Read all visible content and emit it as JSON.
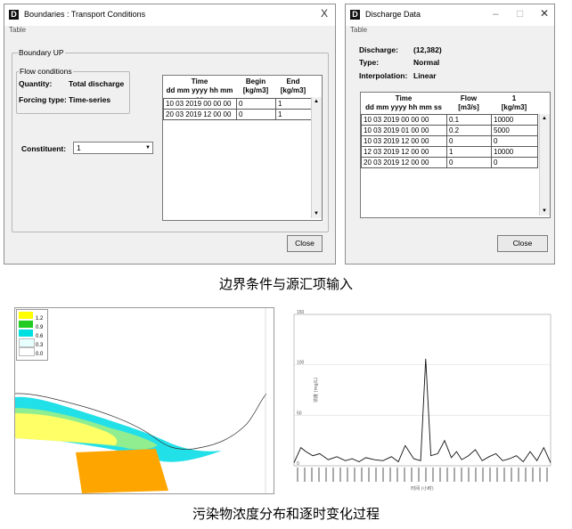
{
  "boundaries_window": {
    "title": "Boundaries : Transport Conditions",
    "menu": "Table",
    "close_glyph": "X",
    "group_label": "Boundary UP",
    "flow_group_label": "Flow conditions",
    "quantity_label": "Quantity:",
    "quantity_value": "Total discharge",
    "forcing_label": "Forcing type:",
    "forcing_value": "Time-series",
    "constituent_label": "Constituent:",
    "constituent_value": "1",
    "table": {
      "headers": [
        {
          "top": "Time",
          "bottom": "dd mm yyyy hh mm ss"
        },
        {
          "top": "Begin",
          "bottom": "[kg/m3]"
        },
        {
          "top": "End",
          "bottom": "[kg/m3]"
        }
      ],
      "rows": [
        [
          "10 03 2019 00 00 00",
          "0",
          "1"
        ],
        [
          "20 03 2019 12 00 00",
          "0",
          "1"
        ]
      ]
    },
    "close_button": "Close"
  },
  "discharge_window": {
    "title": "Discharge Data",
    "menu": "Table",
    "min_glyph": "–",
    "max_glyph": "□",
    "close_glyph": "✕",
    "discharge_label": "Discharge:",
    "discharge_value": "(12,382)",
    "type_label": "Type:",
    "type_value": "Normal",
    "interp_label": "Interpolation:",
    "interp_value": "Linear",
    "table": {
      "headers": [
        {
          "top": "Time",
          "bottom": "dd mm yyyy hh mm ss"
        },
        {
          "top": "Flow",
          "bottom": "[m3/s]"
        },
        {
          "top": "1",
          "bottom": "[kg/m3]"
        }
      ],
      "rows": [
        [
          "10 03 2019 00 00 00",
          "0.1",
          "10000"
        ],
        [
          "10 03 2019 01 00 00",
          "0.2",
          "5000"
        ],
        [
          "10 03 2019 12 00 00",
          "0",
          "0"
        ],
        [
          "12 03 2019 12 00 00",
          "1",
          "10000"
        ],
        [
          "20 03 2019 12 00 00",
          "0",
          "0"
        ]
      ]
    },
    "close_button": "Close"
  },
  "caption_top": "边界条件与源汇项输入",
  "caption_bottom": "污染物浓度分布和逐时变化过程",
  "map_legend": [
    {
      "value": "1.2",
      "color": "#ffff00"
    },
    {
      "value": "0.9",
      "color": "#22cc22"
    },
    {
      "value": "0.6",
      "color": "#00e0e0"
    },
    {
      "value": "0.3",
      "color": "#e8ffff"
    },
    {
      "value": "0.0",
      "color": "#ffffff"
    }
  ],
  "map_colors": {
    "plume_outer": "#22e0e8",
    "plume_mid": "#90ee90",
    "plume_core": "#ffff66",
    "land": "#ffa500"
  },
  "chart_data": {
    "type": "line",
    "ylabel": "浓度 (mg/L)",
    "xlabel": "时间 (小时)",
    "ylim": [
      0,
      150
    ],
    "yticks": [
      "150",
      "100",
      "50",
      "0"
    ],
    "grid": true,
    "x": [
      0,
      4,
      7,
      11,
      15,
      20,
      25,
      30,
      34,
      38,
      42,
      47,
      52,
      57,
      61,
      65,
      70,
      74,
      77,
      80,
      84,
      88,
      92,
      95,
      98,
      102,
      106,
      110,
      114,
      118,
      122,
      126,
      130,
      134,
      138,
      142,
      146,
      150
    ],
    "values": [
      3,
      18,
      14,
      10,
      12,
      6,
      9,
      5,
      7,
      4,
      8,
      6,
      5,
      9,
      4,
      20,
      7,
      5,
      106,
      10,
      12,
      25,
      8,
      14,
      6,
      10,
      16,
      5,
      9,
      12,
      5,
      7,
      10,
      4,
      14,
      5,
      18,
      3
    ]
  }
}
